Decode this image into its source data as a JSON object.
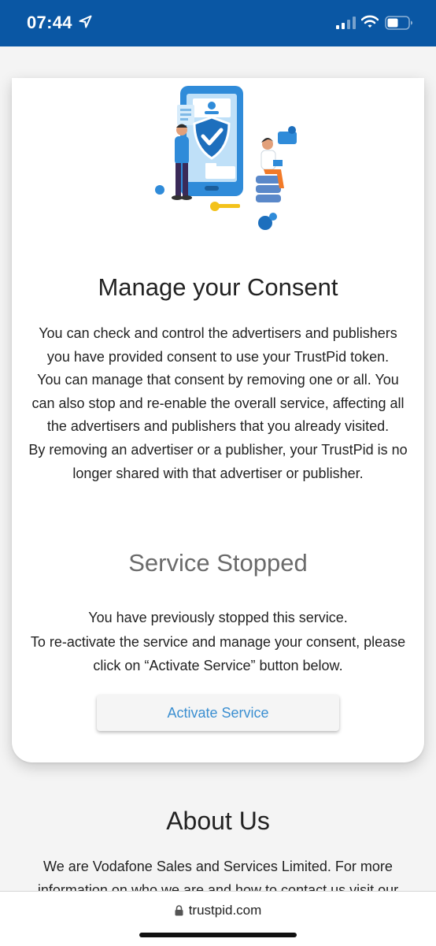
{
  "status_bar": {
    "time": "07:44",
    "icons": [
      "location-arrow-icon",
      "signal-icon",
      "wifi-icon",
      "battery-icon"
    ],
    "background": "#0a57a4"
  },
  "consent": {
    "illustration": "privacy-shield-illustration",
    "title": "Manage your Consent",
    "paragraphs": [
      "You can check and control the advertisers and publishers you have provided consent to use your TrustPid token.",
      "You can manage that consent by removing one or all. You can also stop and re-enable the overall service, affecting all the advertisers and publishers that you already visited.",
      "By removing an advertiser or a publisher, your TrustPid is no longer shared with that advertiser or publisher."
    ]
  },
  "service": {
    "status_title": "Service Stopped",
    "lines": [
      "You have previously stopped this service.",
      "To re-activate the service and manage your consent, please click on “Activate Service” button below."
    ],
    "activate_label": "Activate Service",
    "accent": "#3b8fd1"
  },
  "about": {
    "title": "About Us",
    "text": "We are Vodafone Sales and Services Limited. For more information on who we are and how to contact us visit our Privacy Notice."
  },
  "browser": {
    "url": "trustpid.com",
    "lock_icon": "lock-icon"
  }
}
